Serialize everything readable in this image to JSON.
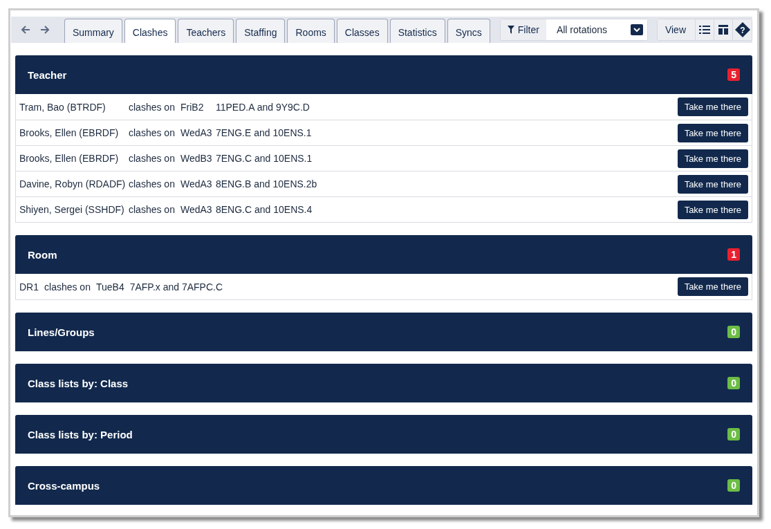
{
  "tabs": [
    {
      "label": "Summary",
      "selected": false
    },
    {
      "label": "Clashes",
      "selected": true
    },
    {
      "label": "Teachers",
      "selected": false
    },
    {
      "label": "Staffing",
      "selected": false
    },
    {
      "label": "Rooms",
      "selected": false
    },
    {
      "label": "Classes",
      "selected": false
    },
    {
      "label": "Statistics",
      "selected": false
    },
    {
      "label": "Syncs",
      "selected": false
    }
  ],
  "filter": {
    "label": "Filter",
    "value": "All rotations"
  },
  "view": {
    "label": "View",
    "help": "?"
  },
  "sections": [
    {
      "title": "Teacher",
      "count": "5",
      "color": "#e8202f",
      "kind": "aligned",
      "rows": [
        {
          "cells": [
            "Tram, Bao (BTRDF)",
            "clashes on",
            "FriB2",
            "11PED.A and 9Y9C.D"
          ],
          "button": "Take me there"
        },
        {
          "cells": [
            "Brooks, Ellen (EBRDF)",
            "clashes on",
            "WedA3",
            "7ENG.E and 10ENS.1"
          ],
          "button": "Take me there"
        },
        {
          "cells": [
            "Brooks, Ellen (EBRDF)",
            "clashes on",
            "WedB3",
            "7ENG.C and 10ENS.1"
          ],
          "button": "Take me there"
        },
        {
          "cells": [
            "Davine, Robyn (RDADF)",
            "clashes on",
            "WedA3",
            "8ENG.B and 10ENS.2b"
          ],
          "button": "Take me there"
        },
        {
          "cells": [
            "Shiyen, Sergei (SSHDF)",
            "clashes on",
            "WedA3",
            "8ENG.C and 10ENS.4"
          ],
          "button": "Take me there"
        }
      ]
    },
    {
      "title": "Room",
      "count": "1",
      "color": "#e8202f",
      "kind": "inline",
      "rows": [
        {
          "cells": [
            "DR1",
            "clashes on",
            "TueB4",
            "7AFP.x and 7AFPC.C"
          ],
          "button": "Take me there"
        }
      ]
    },
    {
      "title": "Lines/Groups",
      "count": "0",
      "color": "#6cbd45"
    },
    {
      "title": "Class lists by: Class",
      "count": "0",
      "color": "#6cbd45"
    },
    {
      "title": "Class lists by: Period",
      "count": "0",
      "color": "#6cbd45"
    },
    {
      "title": "Cross-campus",
      "count": "0",
      "color": "#6cbd45"
    }
  ]
}
